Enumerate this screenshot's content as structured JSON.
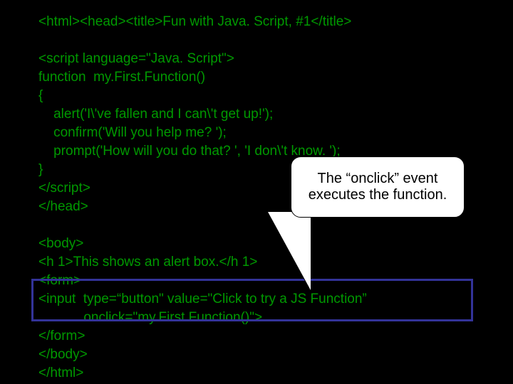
{
  "code_lines": [
    "<html><head><title>Fun with Java. Script, #1</title>",
    "",
    "<script language=\"Java. Script\">",
    "function  my.First.Function()",
    "{",
    "    alert('I\\'ve fallen and I can\\'t get up!');",
    "    confirm('Will you help me? ');",
    "    prompt('How will you do that? ', 'I don\\'t know. ');",
    "}",
    "</script>",
    "</head>",
    "",
    "<body>",
    "<h 1>This shows an alert box.</h 1>",
    "<form>",
    "<input  type=“button\" value=\"Click to try a JS Function”",
    "            onclick=\"my.First.Function()\">",
    "</form>",
    "</body>",
    "</html>"
  ],
  "callout_text": "The “onclick” event executes the function."
}
